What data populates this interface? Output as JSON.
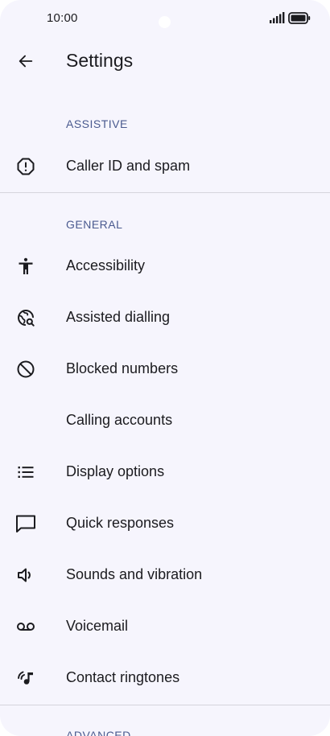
{
  "status_bar": {
    "time": "10:00"
  },
  "header": {
    "title": "Settings",
    "back_icon": "arrow-left-icon"
  },
  "sections": [
    {
      "header": "ASSISTIVE",
      "items": [
        {
          "label": "Caller ID and spam",
          "icon": "alert-circle-icon"
        }
      ]
    },
    {
      "header": "GENERAL",
      "items": [
        {
          "label": "Accessibility",
          "icon": "accessibility-icon"
        },
        {
          "label": "Assisted dialling",
          "icon": "globe-search-icon"
        },
        {
          "label": "Blocked numbers",
          "icon": "block-icon"
        },
        {
          "label": "Calling accounts",
          "icon": ""
        },
        {
          "label": "Display options",
          "icon": "list-icon"
        },
        {
          "label": "Quick responses",
          "icon": "message-icon"
        },
        {
          "label": "Sounds and vibration",
          "icon": "speaker-icon"
        },
        {
          "label": "Voicemail",
          "icon": "voicemail-icon"
        },
        {
          "label": "Contact ringtones",
          "icon": "ringtone-icon"
        }
      ]
    },
    {
      "header": "ADVANCED",
      "items": []
    }
  ],
  "colors": {
    "background": "#f6f5fd",
    "text": "#1b1b1f",
    "section_header": "#4a5a8f",
    "divider": "#d5d4dc"
  }
}
